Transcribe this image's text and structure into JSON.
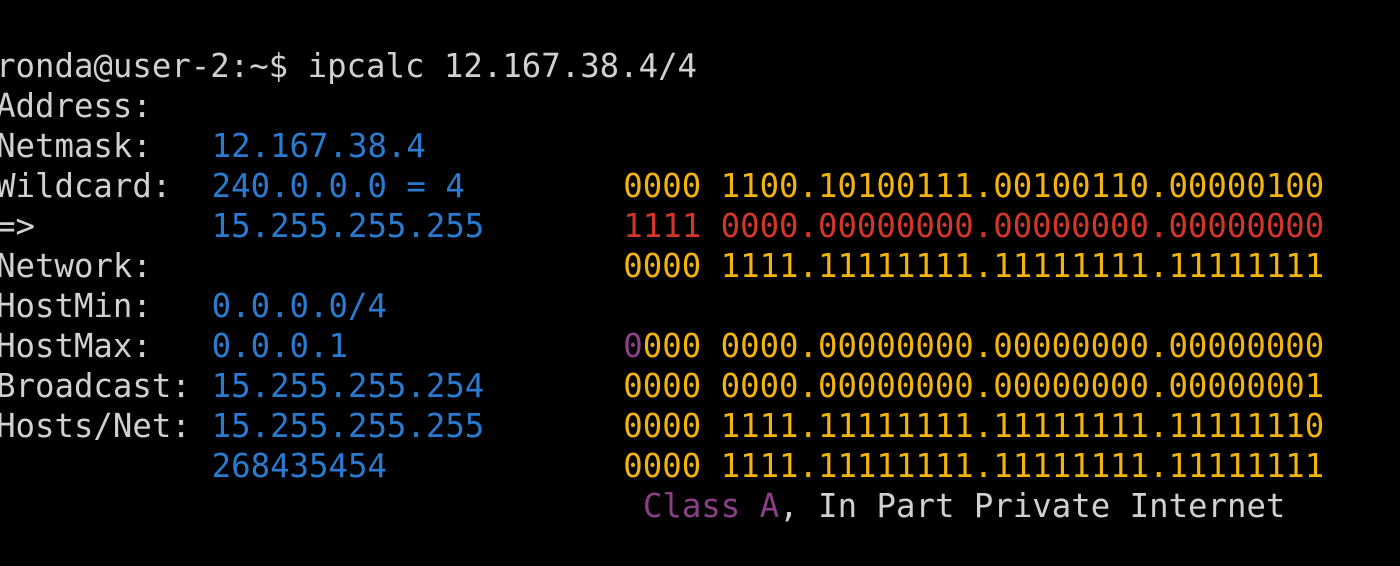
{
  "terminal": {
    "prompt": "ronda@user-2:~$ ",
    "command": "ipcalc 12.167.38.4/4",
    "colors": {
      "text": "#d0d0d0",
      "value": "#2a7bd0",
      "binary_host": "#f2b30c",
      "netmask_bits": "#d2352a",
      "class": "#8b3f88",
      "background": "#000000"
    },
    "rows": {
      "address": {
        "label": "Address:",
        "value": "12.167.38.4",
        "bin_prefix": "0000",
        "bin_rest": " 1100.10100111.00100110.00000100"
      },
      "netmask": {
        "label": "Netmask:",
        "value": "240.0.0.0 = 4",
        "bin_prefix": "1111",
        "bin_rest": " 0000.00000000.00000000.00000000"
      },
      "wildcard": {
        "label": "Wildcard:",
        "value": "15.255.255.255",
        "bin_prefix": "0000",
        "bin_rest": " 1111.11111111.11111111.11111111"
      },
      "arrow": "=>",
      "network": {
        "label": "Network:",
        "value": "0.0.0.0/4",
        "bin_class_bit": "0",
        "bin_prefix_rest": "000",
        "bin_rest": " 0000.00000000.00000000.00000000"
      },
      "hostmin": {
        "label": "HostMin:",
        "value": "0.0.0.1",
        "bin_prefix": "0000",
        "bin_rest": " 0000.00000000.00000000.00000001"
      },
      "hostmax": {
        "label": "HostMax:",
        "value": "15.255.255.254",
        "bin_prefix": "0000",
        "bin_rest": " 1111.11111111.11111111.11111110"
      },
      "broadcast": {
        "label": "Broadcast:",
        "value": "15.255.255.255",
        "bin_prefix": "0000",
        "bin_rest": " 1111.11111111.11111111.11111111"
      },
      "hosts": {
        "label": "Hosts/Net:",
        "value": "268435454",
        "class_text": "Class A",
        "class_suffix": ", In Part Private Internet"
      }
    }
  }
}
